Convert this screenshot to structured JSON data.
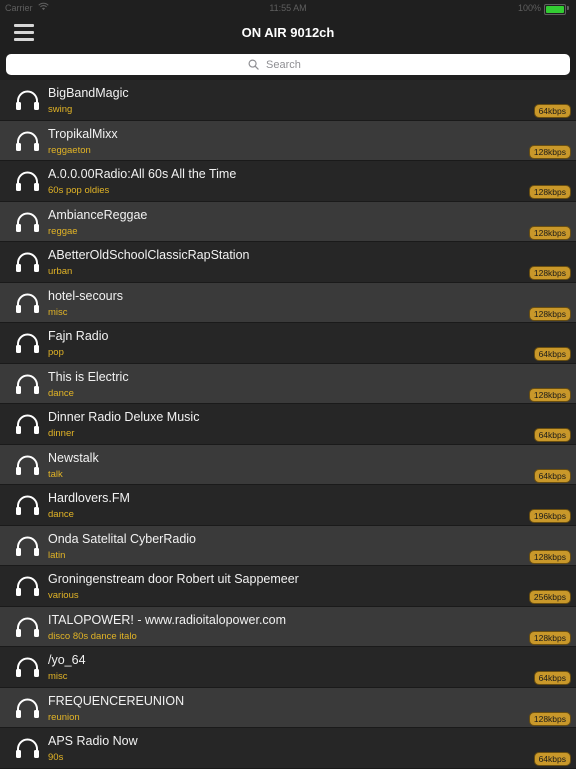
{
  "status": {
    "carrier": "Carrier",
    "time": "11:55 AM",
    "battery": "100%",
    "battery_level": 1.0
  },
  "nav": {
    "title": "ON AIR 9012ch"
  },
  "search": {
    "placeholder": "Search"
  },
  "icons": {
    "menu": "hamburger-menu-icon",
    "search": "magnifier-icon",
    "station": "headphones-icon",
    "wifi": "wifi-icon",
    "battery": "battery-icon"
  },
  "colors": {
    "background": "#1f1f1f",
    "row_dark": "#262626",
    "row_light": "#3a3a3a",
    "genre_text": "#e2b426",
    "badge": "#c9982a",
    "battery": "#33cc33"
  },
  "stations": [
    {
      "name": "BigBandMagic",
      "genre": "swing",
      "bitrate": "64kbps"
    },
    {
      "name": "TropikalMixx",
      "genre": "reggaeton",
      "bitrate": "128kbps"
    },
    {
      "name": "A.0.0.00Radio:All 60s All the Time",
      "genre": "60s pop oldies",
      "bitrate": "128kbps"
    },
    {
      "name": "AmbianceReggae",
      "genre": "reggae",
      "bitrate": "128kbps"
    },
    {
      "name": "ABetterOldSchoolClassicRapStation",
      "genre": "urban",
      "bitrate": "128kbps"
    },
    {
      "name": "hotel-secours",
      "genre": "misc",
      "bitrate": "128kbps"
    },
    {
      "name": "Fajn Radio",
      "genre": "pop",
      "bitrate": "64kbps"
    },
    {
      "name": "This is Electric",
      "genre": "dance",
      "bitrate": "128kbps"
    },
    {
      "name": "Dinner Radio Deluxe Music",
      "genre": "dinner",
      "bitrate": "64kbps"
    },
    {
      "name": "Newstalk",
      "genre": "talk",
      "bitrate": "64kbps"
    },
    {
      "name": "Hardlovers.FM",
      "genre": "dance",
      "bitrate": "196kbps"
    },
    {
      "name": "Onda Satelital CyberRadio",
      "genre": "latin",
      "bitrate": "128kbps"
    },
    {
      "name": "Groningenstream door Robert uit Sappemeer",
      "genre": "various",
      "bitrate": "256kbps"
    },
    {
      "name": "ITALOPOWER! - www.radioitalopower.com",
      "genre": "disco 80s dance italo",
      "bitrate": "128kbps"
    },
    {
      "name": "/yo_64",
      "genre": "misc",
      "bitrate": "64kbps"
    },
    {
      "name": "FREQUENCEREUNION",
      "genre": "reunion",
      "bitrate": "128kbps"
    },
    {
      "name": "APS Radio Now",
      "genre": "90s",
      "bitrate": "64kbps"
    }
  ]
}
